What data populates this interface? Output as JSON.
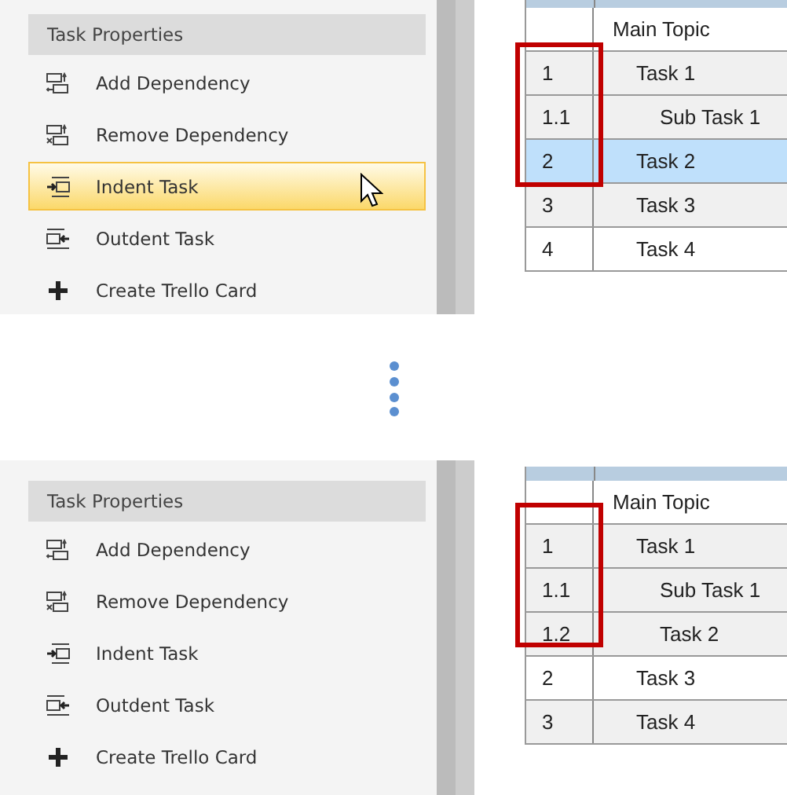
{
  "panels": [
    {
      "sidebar": {
        "title": "Task Properties",
        "items": [
          {
            "label": "Add Dependency",
            "kind": "add-dependency",
            "highlighted": false,
            "hovered": false
          },
          {
            "label": "Remove Dependency",
            "kind": "remove-dependency",
            "highlighted": false,
            "hovered": false
          },
          {
            "label": "Indent Task",
            "kind": "indent",
            "highlighted": true,
            "hovered": true
          },
          {
            "label": "Outdent Task",
            "kind": "outdent",
            "highlighted": false,
            "hovered": false
          },
          {
            "label": "Create Trello Card",
            "kind": "plus",
            "highlighted": false,
            "hovered": false
          }
        ]
      },
      "table": {
        "rows": [
          {
            "number": "",
            "name": "Main Topic",
            "shaded": false,
            "selected": false,
            "framed": false,
            "children": [
              {
                "number": "1",
                "name": "Task 1",
                "shaded": true,
                "selected": false,
                "framed": true,
                "children": [
                  {
                    "number": "1.1",
                    "name": "Sub Task 1",
                    "shaded": true,
                    "selected": false,
                    "framed": true
                  }
                ]
              },
              {
                "number": "2",
                "name": "Task 2",
                "shaded": false,
                "selected": true,
                "framed": true
              },
              {
                "number": "3",
                "name": "Task 3",
                "shaded": true,
                "selected": false,
                "framed": false
              },
              {
                "number": "4",
                "name": "Task 4",
                "shaded": false,
                "selected": false,
                "framed": false
              }
            ]
          }
        ]
      }
    },
    {
      "sidebar": {
        "title": "Task Properties",
        "items": [
          {
            "label": "Add Dependency",
            "kind": "add-dependency",
            "highlighted": false,
            "hovered": false
          },
          {
            "label": "Remove Dependency",
            "kind": "remove-dependency",
            "highlighted": false,
            "hovered": false
          },
          {
            "label": "Indent Task",
            "kind": "indent",
            "highlighted": false,
            "hovered": false
          },
          {
            "label": "Outdent Task",
            "kind": "outdent",
            "highlighted": false,
            "hovered": false
          },
          {
            "label": "Create Trello Card",
            "kind": "plus",
            "highlighted": false,
            "hovered": false
          }
        ]
      },
      "table": {
        "rows": [
          {
            "number": "",
            "name": "Main Topic",
            "shaded": false,
            "selected": false,
            "framed": false,
            "children": [
              {
                "number": "1",
                "name": "Task 1",
                "shaded": true,
                "selected": false,
                "framed": true,
                "children": [
                  {
                    "number": "1.1",
                    "name": "Sub Task 1",
                    "shaded": true,
                    "selected": false,
                    "framed": true
                  },
                  {
                    "number": "1.2",
                    "name": "Task 2",
                    "shaded": true,
                    "selected": false,
                    "framed": true
                  }
                ]
              },
              {
                "number": "2",
                "name": "Task 3",
                "shaded": false,
                "selected": false,
                "framed": false
              },
              {
                "number": "3",
                "name": "Task 4",
                "shaded": true,
                "selected": false,
                "framed": false
              }
            ]
          }
        ]
      }
    }
  ]
}
